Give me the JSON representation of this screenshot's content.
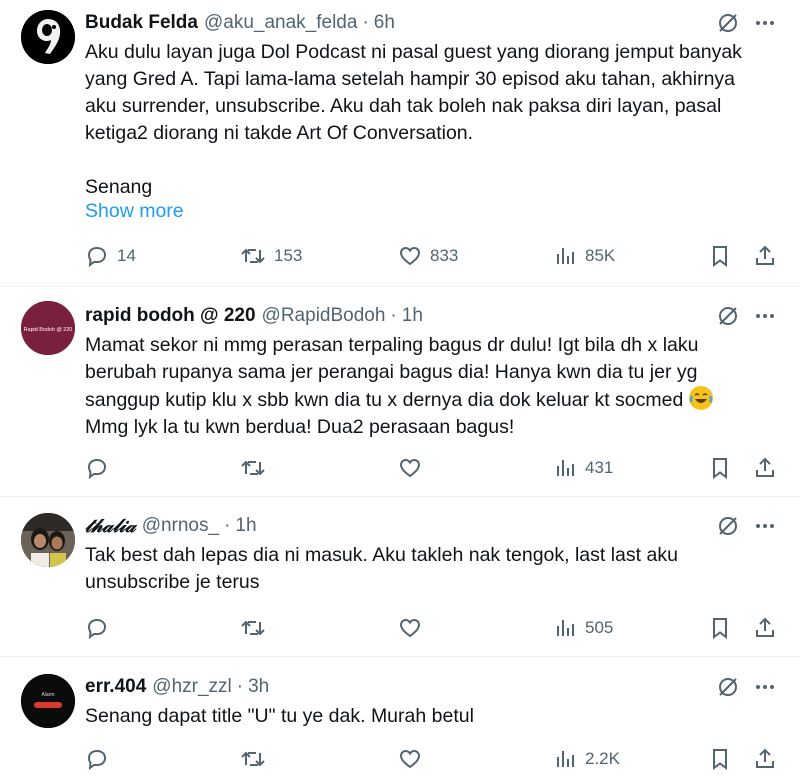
{
  "tweets": [
    {
      "name": "Budak Felda",
      "handle": "@aku_anak_felda",
      "time": "6h",
      "lines": [
        "Aku dulu layan juga Dol Podcast ni pasal guest yang diorang jemput banyak",
        "yang Gred A. Tapi lama-lama setelah hampir 30 episod aku tahan, akhirnya",
        "aku surrender, unsubscribe. Aku dah tak boleh nak paksa diri layan, pasal",
        "ketiga2 diorang ni takde Art Of Conversation.",
        "",
        "Senang"
      ],
      "show_more": "Show more",
      "replies": "14",
      "retweets": "153",
      "likes": "833",
      "views": "85K"
    },
    {
      "name": "rapid bodoh @ 220",
      "handle": "@RapidBodoh",
      "time": "1h",
      "avatar_text": "Rapid Bodoh @ 220",
      "lines": [
        "Mamat sekor ni mmg perasan terpaling bagus dr dulu! Igt bila dh x laku",
        "berubah rupanya sama jer perangai bagus dia! Hanya kwn dia tu jer yg",
        "sanggup kutip klu x sbb kwn dia tu x dernya dia dok keluar kt socmed",
        "Mmg lyk la tu kwn berdua! Dua2 perasaan bagus!"
      ],
      "replies": "",
      "retweets": "",
      "likes": "",
      "views": "431"
    },
    {
      "name": "𝓉𝒽𝒶𝓁𝒾𝒶",
      "handle": "@nrnos_",
      "time": "1h",
      "lines": [
        "Tak best dah lepas dia ni masuk. Aku takleh nak tengok, last last aku",
        "unsubscribe je terus"
      ],
      "replies": "",
      "retweets": "",
      "likes": "",
      "views": "505"
    },
    {
      "name": "err.404",
      "handle": "@hzr_zzl",
      "time": "3h",
      "avatar_text": "Alarm",
      "lines": [
        "Senang dapat title \"U\" tu ye dak. Murah betul"
      ],
      "replies": "",
      "retweets": "",
      "likes": "",
      "views": "2.2K"
    }
  ],
  "separator": "·",
  "icons": {
    "grok": "slash-circle-icon",
    "more": "more-dots-icon",
    "reply": "reply-bubble-icon",
    "retweet": "retweet-icon",
    "like": "heart-icon",
    "views": "views-bars-icon",
    "bookmark": "bookmark-icon",
    "share": "share-upload-icon",
    "emoji": "face-with-tears-of-joy-icon"
  },
  "colors": {
    "text": "#0f1419",
    "secondary": "#536471",
    "link": "#1d9bf0",
    "divider": "#eff3f4",
    "avatar2": "#7a1f3d"
  }
}
